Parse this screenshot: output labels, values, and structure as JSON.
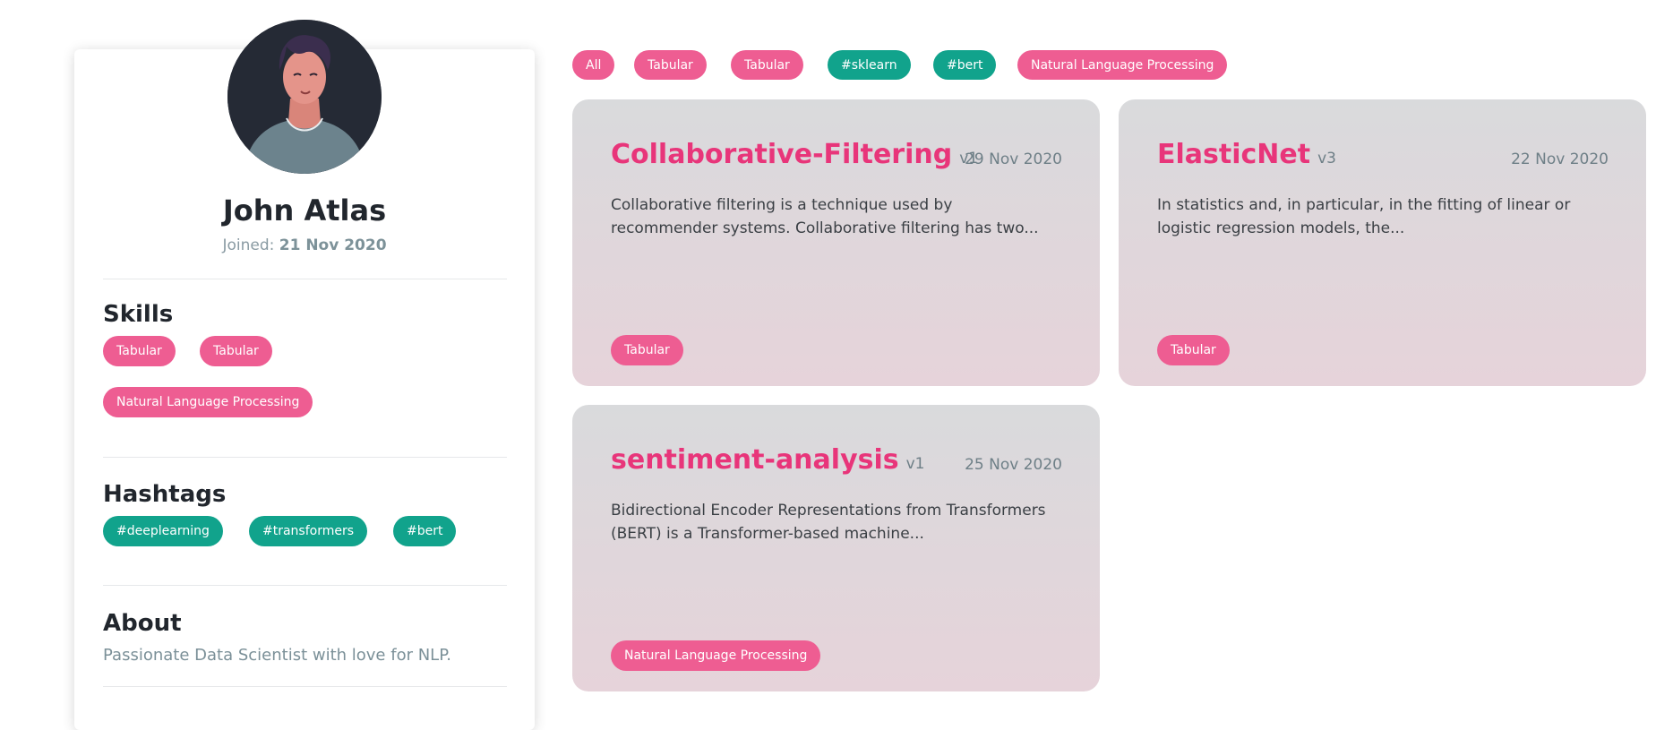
{
  "profile": {
    "name": "John Atlas",
    "joined_label": "Joined:",
    "joined_date": "21 Nov 2020",
    "skills_title": "Skills",
    "skills": [
      "Tabular",
      "Tabular",
      "Natural Language Processing"
    ],
    "hashtags_title": "Hashtags",
    "hashtags": [
      "#deeplearning",
      "#transformers",
      "#bert"
    ],
    "about_title": "About",
    "about_text": "Passionate Data Scientist with love for NLP."
  },
  "filters": [
    "All",
    "Tabular",
    "Tabular",
    "#sklearn",
    "#bert",
    "Natural Language Processing"
  ],
  "cards": [
    {
      "title": "Collaborative-Filtering",
      "version": "v1",
      "date": "29 Nov 2020",
      "description": "Collaborative filtering is a technique used by recommender systems. Collaborative filtering has two...",
      "tag": "Tabular"
    },
    {
      "title": "ElasticNet",
      "version": "v3",
      "date": "22 Nov 2020",
      "description": "In statistics and, in particular, in the fitting of linear or logistic regression models, the...",
      "tag": "Tabular"
    },
    {
      "title": "sentiment-analysis",
      "version": "v1",
      "date": "25 Nov 2020",
      "description": "Bidirectional Encoder Representations from Transformers (BERT) is a Transformer-based machine...",
      "tag": "Natural Language Processing"
    }
  ],
  "colors": {
    "accent_pink": "#ee5d92",
    "title_pink": "#e8357a",
    "hashtag_teal": "#11a38c"
  },
  "icons": {
    "avatar": "user-avatar-illustration"
  }
}
